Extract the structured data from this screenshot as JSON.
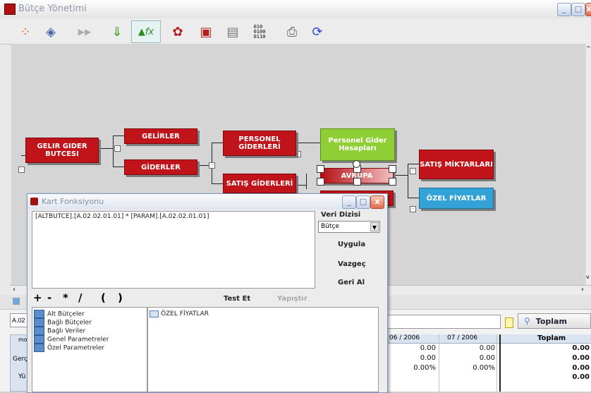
{
  "window": {
    "title": "Bütçe Yönetimi"
  },
  "toolbar": {
    "icons": [
      "tree-icon",
      "eraser-icon",
      "fast-forward-icon",
      "arrow-down-icon",
      "formula-fx-icon",
      "users-gear-icon",
      "user-card-icon",
      "report-icon",
      "binary-icon",
      "printer-icon",
      "refresh-icon"
    ],
    "fx_label": "fx",
    "bin_label": "010\n0100\n0110"
  },
  "diagram": {
    "nodes": {
      "root": "GELIR GIDER BUTCESI",
      "gelirler": "GELİRLER",
      "giderler": "GİDERLER",
      "personel": "PERSONEL GİDERLERİ",
      "satis": "SATIŞ GİDERLERİ",
      "personel_hesap": "Personel Gider Hesapları",
      "avrupa": "AVRUPA",
      "satis_miktar": "SATIŞ MİKTARLARI",
      "ozel_fiyat": "ÖZEL FİYATLAR"
    }
  },
  "bottom": {
    "code_field": "A.02",
    "toplam_button": "Toplam",
    "row_labels": [
      "mo",
      "Gerç",
      "Yü"
    ],
    "columns": [
      "06 / 2006",
      "07 / 2006",
      "Toplam"
    ],
    "rows": [
      [
        "0.00",
        "0.00",
        "0.00"
      ],
      [
        "0.00",
        "0.00",
        "0.00"
      ],
      [
        "0.00%",
        "0.00%",
        "0.00"
      ],
      [
        "",
        "",
        "0.00"
      ]
    ]
  },
  "dialog": {
    "title": "Kart Fonksiyonu",
    "formula": "[ALTBUTCE].[A.02.02.01.01]  * [PARAM].[A.02.02.01.01]",
    "veri_dizisi_label": "Veri Dizisi",
    "veri_dizisi_value": "Bütçe",
    "buttons": {
      "uygula": "Uygula",
      "vazgec": "Vazgeç",
      "geri_al": "Geri Al",
      "test_et": "Test Et",
      "yapistir": "Yapıştır"
    },
    "operators": [
      "+",
      "-",
      "*",
      "/",
      "(",
      ")"
    ],
    "tree_items": [
      "Alt Bütçeler",
      "Bağlı Bütçeler",
      "Bağlı Veriler",
      "Genel Parametreler",
      "Özel Parametreler"
    ],
    "right_list": [
      "ÖZEL FİYATLAR"
    ]
  }
}
